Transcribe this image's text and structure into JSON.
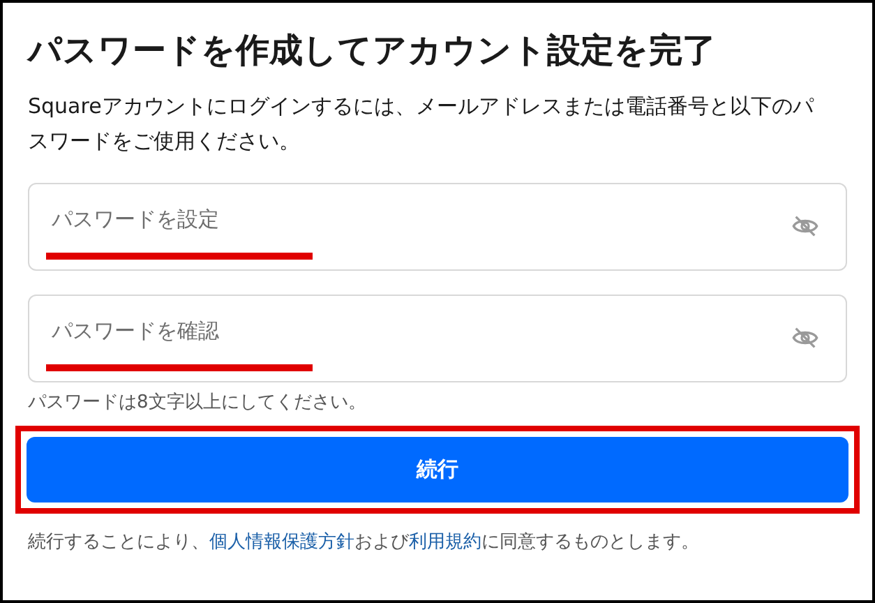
{
  "title": "パスワードを作成してアカウント設定を完了",
  "description": "Squareアカウントにログインするには、メールアドレスまたは電話番号と以下のパスワードをご使用ください。",
  "fields": [
    {
      "placeholder": "パスワードを設定"
    },
    {
      "placeholder": "パスワードを確認"
    }
  ],
  "hint": "パスワードは8文字以上にしてください。",
  "button": "続行",
  "footer": [
    {
      "kind": "text",
      "text": "続行することにより、"
    },
    {
      "kind": "link",
      "text": "個人情報保護方針"
    },
    {
      "kind": "text",
      "text": "および"
    },
    {
      "kind": "link",
      "text": "利用規約"
    },
    {
      "kind": "text",
      "text": "に同意するものとします。"
    }
  ]
}
